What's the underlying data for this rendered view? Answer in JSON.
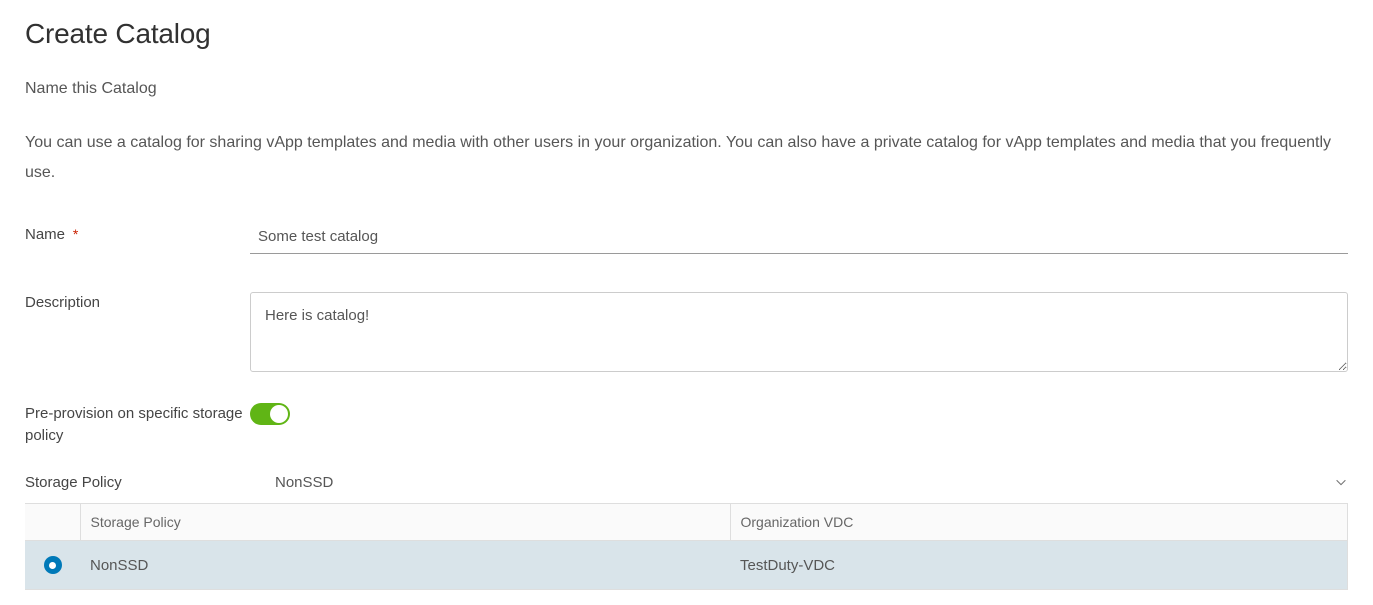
{
  "page": {
    "title": "Create Catalog",
    "subtitle": "Name this Catalog",
    "helpText": "You can use a catalog for sharing vApp templates and media with other users in your organization. You can also have a private catalog for vApp templates and media that you frequently use."
  },
  "form": {
    "nameLabel": "Name",
    "nameRequiredMark": "*",
    "nameValue": "Some test catalog",
    "descriptionLabel": "Description",
    "descriptionValue": "Here is catalog!",
    "preprovisionLabel": "Pre-provision on specific storage policy",
    "preprovisionEnabled": true,
    "storagePolicyLabel": "Storage Policy",
    "storagePolicySelected": "NonSSD"
  },
  "table": {
    "headers": {
      "storagePolicy": "Storage Policy",
      "orgVdc": "Organization VDC"
    },
    "rows": [
      {
        "storagePolicy": "NonSSD",
        "orgVdc": "TestDuty-VDC",
        "selected": true
      }
    ]
  }
}
